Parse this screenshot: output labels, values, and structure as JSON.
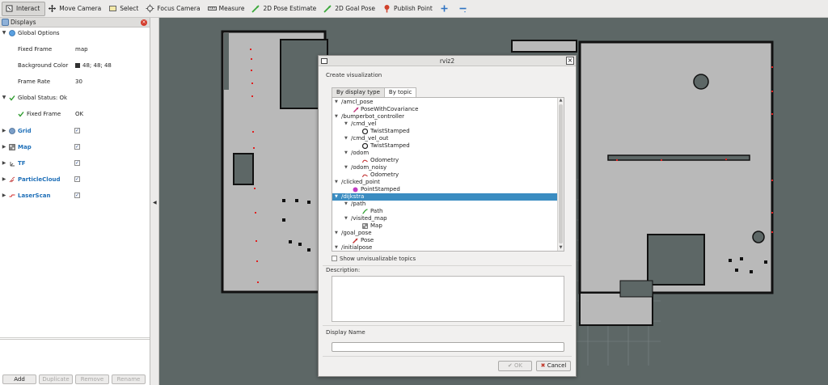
{
  "toolbar": {
    "tools": [
      {
        "label": "Interact",
        "icon": "interact-icon",
        "active": true
      },
      {
        "label": "Move Camera",
        "icon": "move-camera-icon"
      },
      {
        "label": "Select",
        "icon": "select-icon"
      },
      {
        "label": "Focus Camera",
        "icon": "focus-camera-icon"
      },
      {
        "label": "Measure",
        "icon": "measure-icon"
      },
      {
        "label": "2D Pose Estimate",
        "icon": "pose-estimate-icon"
      },
      {
        "label": "2D Goal Pose",
        "icon": "goal-pose-icon"
      },
      {
        "label": "Publish Point",
        "icon": "publish-point-icon"
      }
    ]
  },
  "displays": {
    "title": "Displays",
    "global_options": "Global Options",
    "fixed_frame_label": "Fixed Frame",
    "fixed_frame_value": "map",
    "background_color_label": "Background Color",
    "background_color_value": "48; 48; 48",
    "frame_rate_label": "Frame Rate",
    "frame_rate_value": "30",
    "global_status": "Global Status: Ok",
    "fixed_frame_status_label": "Fixed Frame",
    "fixed_frame_status_value": "OK",
    "items": [
      {
        "label": "Grid",
        "icon": "grid-icon",
        "checked": true
      },
      {
        "label": "Map",
        "icon": "map-icon",
        "checked": true
      },
      {
        "label": "TF",
        "icon": "tf-icon",
        "checked": true
      },
      {
        "label": "ParticleCloud",
        "icon": "particle-cloud-icon",
        "checked": true
      },
      {
        "label": "LaserScan",
        "icon": "laser-scan-icon",
        "checked": true
      }
    ],
    "buttons": {
      "add": "Add",
      "duplicate": "Duplicate",
      "remove": "Remove",
      "rename": "Rename"
    }
  },
  "dialog": {
    "window_title": "rviz2",
    "heading": "Create visualization",
    "tabs": [
      "By display type",
      "By topic"
    ],
    "active_tab": "By topic",
    "topics": [
      {
        "text": "/amcl_pose",
        "level": 0,
        "arrow": true
      },
      {
        "text": "PoseWithCovariance",
        "level": 2,
        "icon": "pose-covariance-icon"
      },
      {
        "text": "/bumperbot_controller",
        "level": 0,
        "arrow": true
      },
      {
        "text": "/cmd_vel",
        "level": 1,
        "arrow": true
      },
      {
        "text": "TwistStamped",
        "level": 2,
        "icon": "twist-icon"
      },
      {
        "text": "/cmd_vel_out",
        "level": 1,
        "arrow": true
      },
      {
        "text": "TwistStamped",
        "level": 2,
        "icon": "twist-icon"
      },
      {
        "text": "/odom",
        "level": 1,
        "arrow": true
      },
      {
        "text": "Odometry",
        "level": 2,
        "icon": "odometry-icon"
      },
      {
        "text": "/odom_noisy",
        "level": 1,
        "arrow": true
      },
      {
        "text": "Odometry",
        "level": 2,
        "icon": "odometry-icon"
      },
      {
        "text": "/clicked_point",
        "level": 0,
        "arrow": true
      },
      {
        "text": "PointStamped",
        "level": 1,
        "icon": "point-icon"
      },
      {
        "text": "/dijkstra",
        "level": 0,
        "arrow": true,
        "selected": true
      },
      {
        "text": "/path",
        "level": 1,
        "arrow": true
      },
      {
        "text": "Path",
        "level": 2,
        "icon": "path-icon"
      },
      {
        "text": "/visited_map",
        "level": 1,
        "arrow": true
      },
      {
        "text": "Map",
        "level": 2,
        "icon": "map-icon"
      },
      {
        "text": "/goal_pose",
        "level": 0,
        "arrow": true
      },
      {
        "text": "Pose",
        "level": 1,
        "icon": "pose-icon"
      },
      {
        "text": "/initialpose",
        "level": 0,
        "arrow": true
      }
    ],
    "show_unvisualizable": "Show unvisualizable topics",
    "description_label": "Description:",
    "display_name_label": "Display Name",
    "display_name_value": "",
    "ok_label": "OK",
    "cancel_label": "Cancel"
  },
  "colors": {
    "accent": "#3a8cc1",
    "map_free": "#b9b9b9",
    "map_unknown": "#5d6766",
    "laser": "#e02020"
  }
}
